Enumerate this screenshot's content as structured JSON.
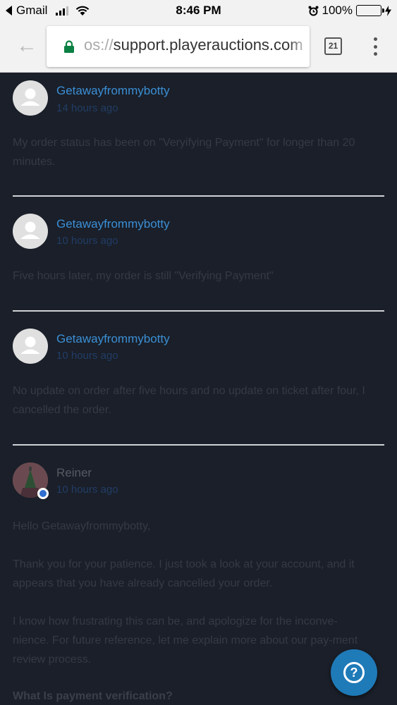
{
  "statusbar": {
    "back_app": "Gmail",
    "time": "8:46 PM",
    "battery_pct": "100%"
  },
  "browser": {
    "url_faded": "os://",
    "url_main": "support.playerauctions.com",
    "tab_count": "21"
  },
  "comments": [
    {
      "author": "Getawayfrommybotty",
      "time": "14 hours ago",
      "body": "My order status has been on \"Veryifying Payment\" for longer than 20 minutes."
    },
    {
      "author": "Getawayfrommybotty",
      "time": "10 hours ago",
      "body": "Five hours later, my order is still \"Verifying Payment\""
    },
    {
      "author": "Getawayfrommybotty",
      "time": "10 hours ago",
      "body": "No update on order after five hours and no update on ticket after four, I cancelled the order."
    },
    {
      "author": "Reiner",
      "time": "10 hours ago",
      "p1": "Hello Getawayfrommybotty,",
      "p2": "Thank you for your patience. I just took a look at your account, and it appears that you have already cancelled your order.",
      "p3": "I know how frustrating this can be, and apologize for the inconve-nience. For future reference, let me explain more about our pay-ment review process.",
      "heading": "What Is payment verification?"
    }
  ],
  "colors": {
    "background": "#1a1f29",
    "author_link": "#3b8fd6",
    "help_button": "#1f7ab8"
  },
  "icons": {
    "help": "question-mark-icon",
    "menu": "overflow-menu-icon",
    "lock": "lock-icon"
  }
}
